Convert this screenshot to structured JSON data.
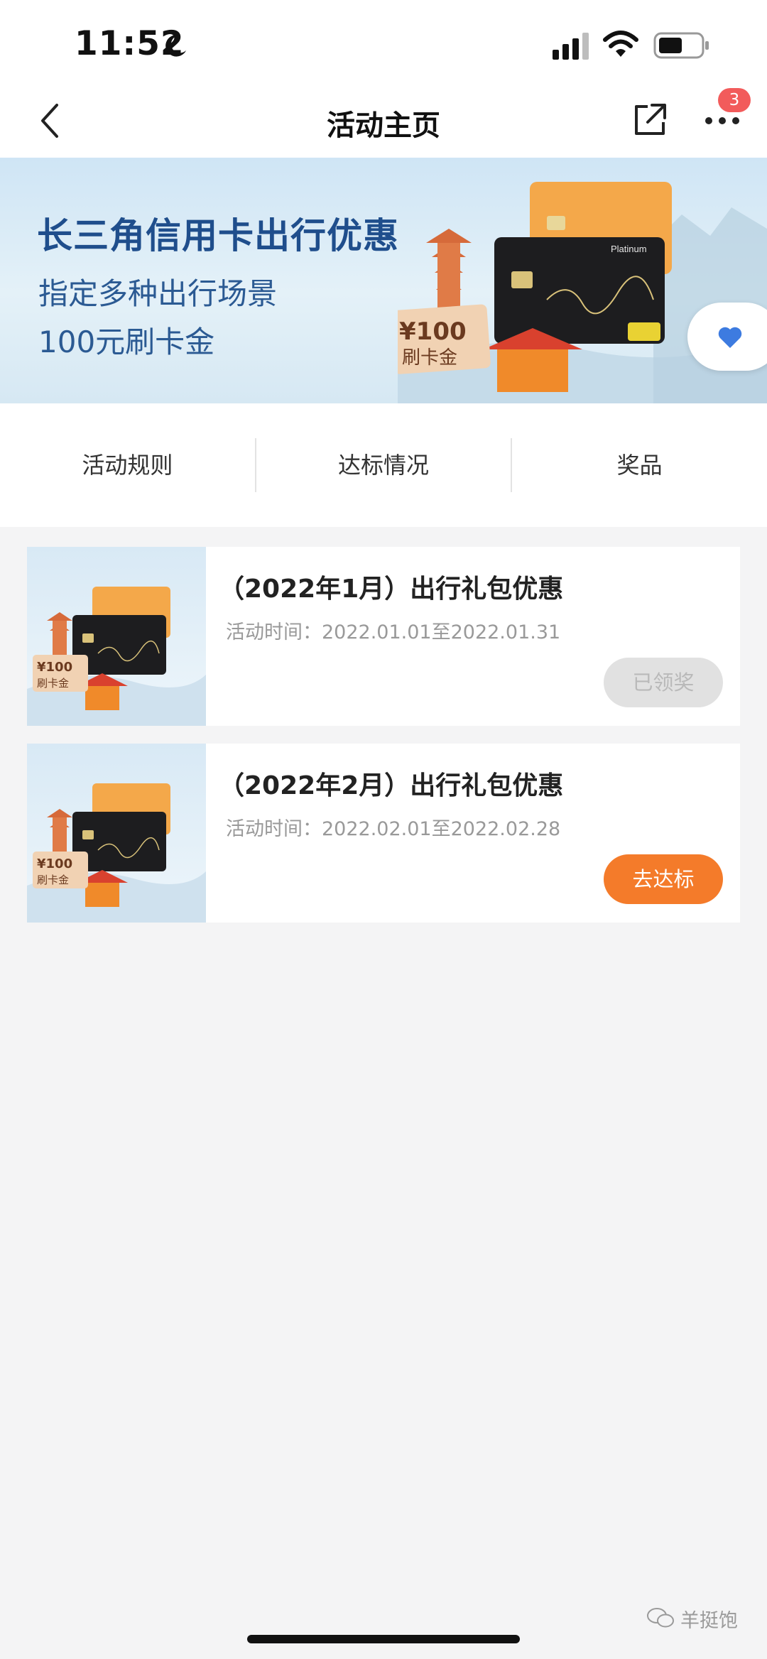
{
  "status_bar": {
    "time": "11:52"
  },
  "nav": {
    "title": "活动主页",
    "badge_count": "3"
  },
  "banner": {
    "title": "长三角信用卡出行优惠",
    "subtitle_line1": "指定多种出行场景",
    "subtitle_line2": "100元刷卡金",
    "coupon_amount": "¥100",
    "coupon_label": "刷卡金",
    "card_tier": "Platinum"
  },
  "tabs": [
    {
      "label": "活动规则"
    },
    {
      "label": "达标情况"
    },
    {
      "label": "奖品"
    }
  ],
  "activities": [
    {
      "title": "（2022年1月）出行礼包优惠",
      "time": "活动时间：2022.01.01至2022.01.31",
      "button": "已领奖",
      "button_state": "disabled",
      "thumb_amount": "¥100",
      "thumb_label": "刷卡金"
    },
    {
      "title": "（2022年2月）出行礼包优惠",
      "time": "活动时间：2022.02.01至2022.02.28",
      "button": "去达标",
      "button_state": "active",
      "thumb_amount": "¥100",
      "thumb_label": "刷卡金"
    }
  ],
  "footer": {
    "watermark": "羊挺饱"
  },
  "colors": {
    "accent": "#f47b2a",
    "badge": "#f25b5b",
    "banner_text": "#1f4e8c",
    "disabled": "#e1e1e1"
  }
}
